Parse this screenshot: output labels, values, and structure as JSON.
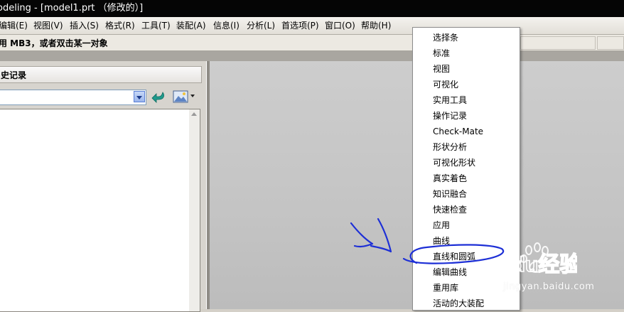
{
  "window": {
    "title": "odeling - [model1.prt （修改的）]"
  },
  "menubar": {
    "items": [
      {
        "label": "编辑(E)"
      },
      {
        "label": "视图(V)"
      },
      {
        "label": "插入(S)"
      },
      {
        "label": "格式(R)"
      },
      {
        "label": "工具(T)"
      },
      {
        "label": "装配(A)"
      },
      {
        "label": "信息(I)"
      },
      {
        "label": "分析(L)"
      },
      {
        "label": "首选项(P)"
      },
      {
        "label": "窗口(O)"
      },
      {
        "label": "帮助(H)"
      }
    ]
  },
  "status": {
    "text": "用 MB3，或者双击某一对象"
  },
  "navigator": {
    "header": "史记录",
    "dropdown_value": ""
  },
  "popup_menu": {
    "items": [
      {
        "label": "选择条"
      },
      {
        "label": "标准"
      },
      {
        "label": "视图"
      },
      {
        "label": "可视化"
      },
      {
        "label": "实用工具"
      },
      {
        "label": "操作记录"
      },
      {
        "label": "Check-Mate"
      },
      {
        "label": "形状分析"
      },
      {
        "label": "可视化形状"
      },
      {
        "label": "真实着色"
      },
      {
        "label": "知识融合"
      },
      {
        "label": "快速检查"
      },
      {
        "label": "应用"
      },
      {
        "label": "曲线"
      },
      {
        "label": "直线和圆弧"
      },
      {
        "label": "编辑曲线"
      },
      {
        "label": "重用库"
      },
      {
        "label": "活动的大装配"
      }
    ],
    "highlighted_item": "直线和圆弧"
  },
  "annotation": {
    "color": "#1d2fd6"
  },
  "watermark": {
    "logo_text": "Baidu经验",
    "url": "jingyan.baidu.com"
  }
}
